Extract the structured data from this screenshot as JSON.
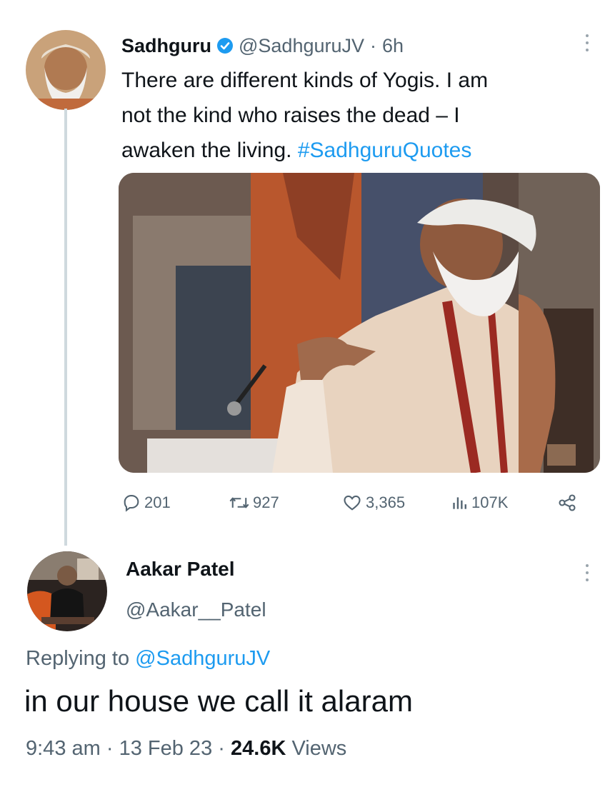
{
  "tweet": {
    "author_name": "Sadhguru",
    "author_handle": "@SadhguruJV",
    "separator": "·",
    "time": "6h",
    "text_line1": "There are different kinds of Yogis. I am",
    "text_line2": "not the kind who raises the dead – I",
    "text_line3": "awaken the living.",
    "hashtag": "#SadhguruQuotes",
    "stats": {
      "replies": "201",
      "retweets": "927",
      "likes": "3,365",
      "views": "107K"
    }
  },
  "reply": {
    "author_name": "Aakar Patel",
    "author_handle": "@Aakar__Patel",
    "replying_prefix": "Replying to",
    "replying_to": "@SadhguruJV",
    "text": "in our house we call it alaram",
    "time": "9:43 am",
    "separator1": "·",
    "date": "13 Feb 23",
    "separator2": "·",
    "views_count": "24.6K",
    "views_label": "Views"
  },
  "colors": {
    "link": "#1d9bf0",
    "muted": "#536471",
    "text": "#0f1419",
    "thread_line": "#cfd9de"
  }
}
